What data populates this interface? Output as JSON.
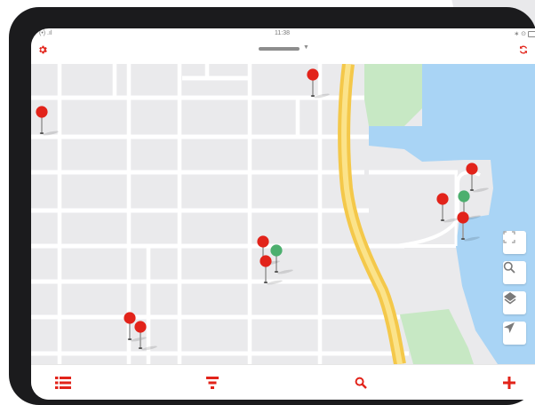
{
  "status": {
    "time": "11:38",
    "signal": "(•) .ıl",
    "right": "∗ ⊙"
  },
  "colors": {
    "accent": "#e2231a",
    "pin_red": "#e2231a",
    "pin_green": "#4caf6e",
    "water": "#a9d4f5",
    "park": "#c7e8c4",
    "highway": "#f8d86a",
    "road": "#ffffff",
    "land": "#eaeaec"
  },
  "header": {
    "left_icon": "gear-icon",
    "center": "title-dropdown",
    "right_icon": "refresh-icon"
  },
  "map_controls": [
    "fullscreen-icon",
    "search-icon",
    "layers-icon",
    "navigate-icon"
  ],
  "pins": [
    {
      "color": "red"
    },
    {
      "color": "red"
    },
    {
      "color": "green"
    },
    {
      "color": "red"
    },
    {
      "color": "red"
    },
    {
      "color": "red"
    },
    {
      "color": "red"
    },
    {
      "color": "green"
    },
    {
      "color": "red"
    },
    {
      "color": "red"
    },
    {
      "color": "red"
    }
  ],
  "toolbar": {
    "items": [
      "list-icon",
      "filter-icon",
      "search-icon",
      "add-icon"
    ]
  }
}
